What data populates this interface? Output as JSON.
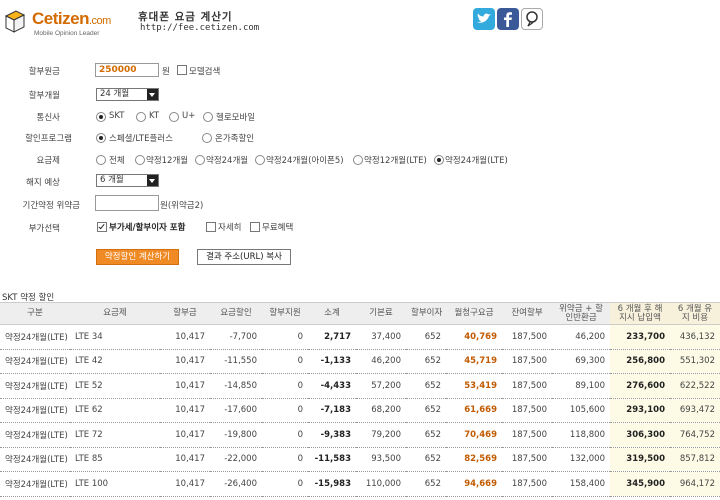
{
  "header": {
    "logo_text": "Cetizen",
    "logo_suffix": ".com",
    "logo_tagline": "Mobile Opinion Leader",
    "title": "휴대폰 요금 계산기",
    "url": "http://fee.cetizen.com",
    "social": [
      "twitter-icon",
      "facebook-icon",
      "me2day-icon"
    ],
    "colors": {
      "twitter": "#33aadd",
      "facebook": "#3b5998",
      "me2day": "#6ab02a",
      "accent": "#f08a24"
    }
  },
  "form": {
    "installment_amount": {
      "label": "할부원금",
      "value": "250000",
      "unit": "원",
      "model_search_label": "모델검색"
    },
    "installment_months": {
      "label": "할부개월",
      "value": "24 개월"
    },
    "carrier": {
      "label": "통신사",
      "options": [
        "SKT",
        "KT",
        "U+",
        "헬로모바일"
      ],
      "selected": 0
    },
    "discount_program": {
      "label": "할인프로그램",
      "options": [
        "스페셜/LTE플러스",
        "온가족할인"
      ],
      "selected": 0
    },
    "plan": {
      "label": "요금제",
      "options": [
        "전체",
        "약정12개월",
        "약정24개월",
        "약정24개월(아이폰5)",
        "약정12개월(LTE)",
        "약정24개월(LTE)"
      ],
      "selected": 5
    },
    "cancel_expect": {
      "label": "해지 예상",
      "value": "6 개월"
    },
    "penalty": {
      "label": "기간약정 위약금",
      "value": "",
      "unit": "원(위약금2)"
    },
    "extras": {
      "label": "부가선택",
      "options": [
        "부가세/할부이자 포함",
        "자세히",
        "무료혜택"
      ],
      "checked": [
        true,
        false,
        false
      ]
    },
    "buttons": {
      "calculate": "약정할인 계산하기",
      "copy_url": "결과 주소(URL) 복사"
    }
  },
  "table": {
    "title": "SKT 약정 할인",
    "headers": [
      "구분",
      "요금제",
      "할부금",
      "요금할인",
      "할부지원",
      "소계",
      "기본료",
      "할부이자",
      "월청구요금",
      "잔여할부",
      "위약금 + 할인반환금",
      "6 개월 후 해지시 납입액",
      "6 개월 유지 비용"
    ],
    "rows": [
      [
        "약정24개월(LTE)",
        "LTE 34",
        "10,417",
        "-7,700",
        "0",
        "2,717",
        "37,400",
        "652",
        "40,769",
        "187,500",
        "46,200",
        "233,700",
        "436,132"
      ],
      [
        "약정24개월(LTE)",
        "LTE 42",
        "10,417",
        "-11,550",
        "0",
        "-1,133",
        "46,200",
        "652",
        "45,719",
        "187,500",
        "69,300",
        "256,800",
        "551,302"
      ],
      [
        "약정24개월(LTE)",
        "LTE 52",
        "10,417",
        "-14,850",
        "0",
        "-4,433",
        "57,200",
        "652",
        "53,419",
        "187,500",
        "89,100",
        "276,600",
        "622,522"
      ],
      [
        "약정24개월(LTE)",
        "LTE 62",
        "10,417",
        "-17,600",
        "0",
        "-7,183",
        "68,200",
        "652",
        "61,669",
        "187,500",
        "105,600",
        "293,100",
        "693,472"
      ],
      [
        "약정24개월(LTE)",
        "LTE 72",
        "10,417",
        "-19,800",
        "0",
        "-9,383",
        "79,200",
        "652",
        "70,469",
        "187,500",
        "118,800",
        "306,300",
        "764,752"
      ],
      [
        "약정24개월(LTE)",
        "LTE 85",
        "10,417",
        "-22,000",
        "0",
        "-11,583",
        "93,500",
        "652",
        "82,569",
        "187,500",
        "132,000",
        "319,500",
        "857,812"
      ],
      [
        "약정24개월(LTE)",
        "LTE 100",
        "10,417",
        "-26,400",
        "0",
        "-15,983",
        "110,000",
        "652",
        "94,669",
        "187,500",
        "158,400",
        "345,900",
        "964,172"
      ]
    ]
  }
}
